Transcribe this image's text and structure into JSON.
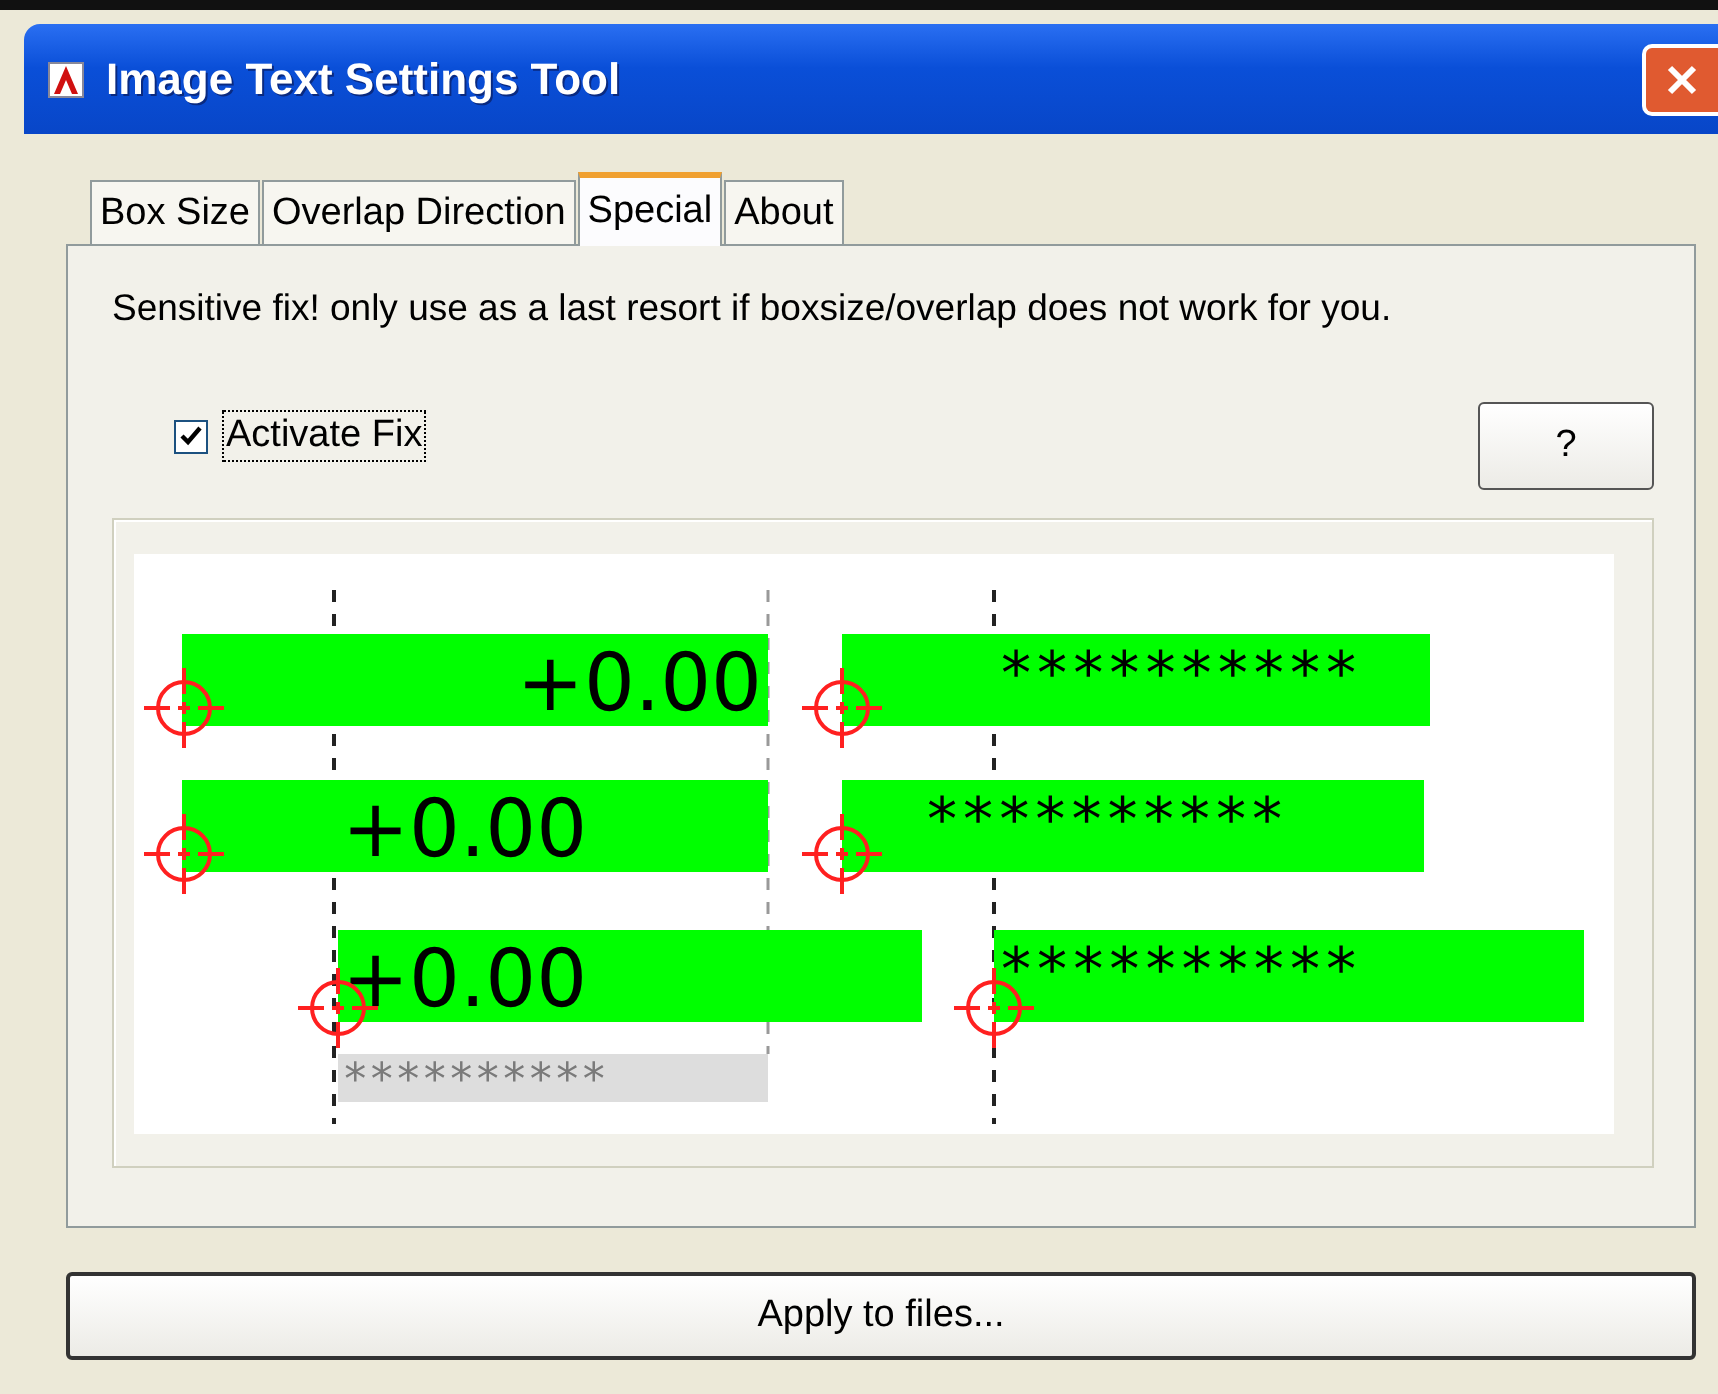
{
  "window": {
    "title": "Image Text Settings Tool"
  },
  "tabs": [
    {
      "label": "Box Size",
      "selected": false
    },
    {
      "label": "Overlap Direction",
      "selected": false
    },
    {
      "label": "Special",
      "selected": true
    },
    {
      "label": "About",
      "selected": false
    }
  ],
  "description": "Sensitive fix! only use as a last resort if boxsize/overlap does not work for you.",
  "activate_fix": {
    "label": "Activate Fix",
    "checked": true
  },
  "help_button": "?",
  "preview": {
    "left_samples": [
      "+0.00",
      "+0.00",
      "+0.00"
    ],
    "right_samples": [
      "**********",
      "**********",
      "**********"
    ],
    "ghost_text": "**********"
  },
  "apply_button": "Apply to files..."
}
